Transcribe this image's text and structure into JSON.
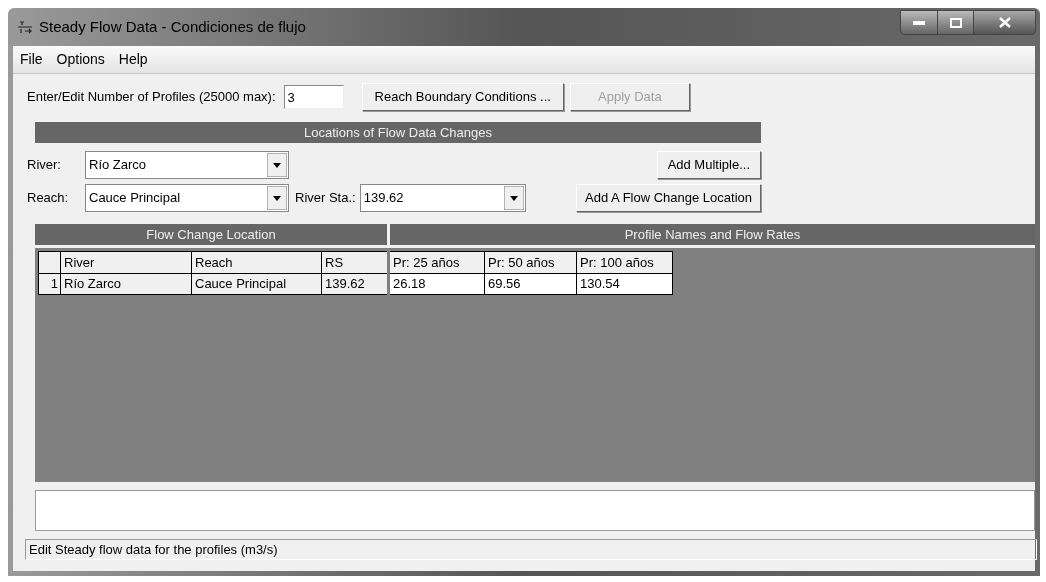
{
  "window": {
    "title": "Steady Flow Data - Condiciones de flujo"
  },
  "menu": [
    "File",
    "Options",
    "Help"
  ],
  "profiles": {
    "label": "Enter/Edit Number of Profiles (25000 max):",
    "value": "3"
  },
  "buttons": [
    {
      "label": "Reach Boundary Conditions ...",
      "disabled": false
    },
    {
      "label": "Apply Data",
      "disabled": true
    }
  ],
  "locations_header": "Locations of Flow Data Changes",
  "river": {
    "label": "River:",
    "value": "Río Zarco"
  },
  "add_multiple": "Add Multiple...",
  "reach": {
    "label": "Reach:",
    "value": "Cauce Principal"
  },
  "river_sta": {
    "label": "River Sta.:",
    "value": "139.62"
  },
  "add_location": "Add A Flow Change Location",
  "table": {
    "group_headers": [
      "Flow Change Location",
      "Profile Names and Flow Rates"
    ],
    "columns": [
      "River",
      "Reach",
      "RS",
      "Pr: 25 años",
      "Pr: 50 años",
      "Pr: 100 años"
    ],
    "rows": [
      {
        "number": "1",
        "cells": [
          "Río Zarco",
          "Cauce Principal",
          "139.62",
          "26.18",
          "69.56",
          "130.54"
        ]
      }
    ]
  },
  "status_bar": "Edit Steady flow data for the profiles (m3/s)"
}
